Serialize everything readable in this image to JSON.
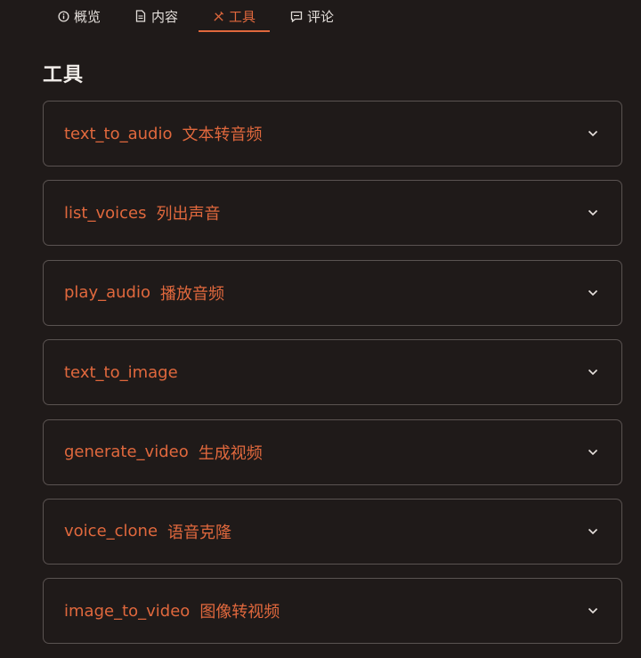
{
  "tabs": [
    {
      "label": "概览",
      "icon": "info-circle-icon",
      "active": false
    },
    {
      "label": "内容",
      "icon": "document-icon",
      "active": false
    },
    {
      "label": "工具",
      "icon": "tools-icon",
      "active": true
    },
    {
      "label": "评论",
      "icon": "comment-icon",
      "active": false
    }
  ],
  "section": {
    "title": "工具"
  },
  "tools": [
    {
      "name": "text_to_audio",
      "desc": "文本转音频"
    },
    {
      "name": "list_voices",
      "desc": "列出声音"
    },
    {
      "name": "play_audio",
      "desc": "播放音频"
    },
    {
      "name": "text_to_image",
      "desc": ""
    },
    {
      "name": "generate_video",
      "desc": "生成视频"
    },
    {
      "name": "voice_clone",
      "desc": "语音克隆"
    },
    {
      "name": "image_to_video",
      "desc": "图像转视频"
    }
  ],
  "colors": {
    "background": "#1f1a19",
    "accent": "#e0683d",
    "border": "#5a5351",
    "text": "#e4dfdb"
  }
}
